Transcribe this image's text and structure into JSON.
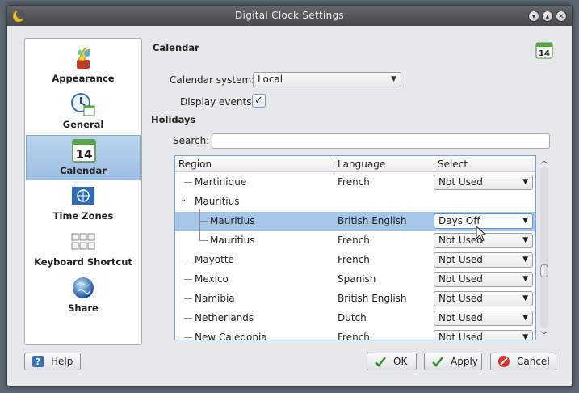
{
  "window": {
    "title": "Digital Clock Settings"
  },
  "sidebar": {
    "items": [
      {
        "label": "Appearance",
        "icon": "paint-brush-icon"
      },
      {
        "label": "General",
        "icon": "clock-calendar-icon"
      },
      {
        "label": "Calendar",
        "icon": "calendar-icon",
        "active": true
      },
      {
        "label": "Time Zones",
        "icon": "un-globe-icon"
      },
      {
        "label": "Keyboard Shortcut",
        "icon": "keyboard-icon"
      },
      {
        "label": "Share",
        "icon": "globe-icon"
      }
    ]
  },
  "page": {
    "title": "Calendar",
    "calendar_icon_text": "14",
    "calendar_system_label": "Calendar system:",
    "calendar_system_value": "Local",
    "display_events_label": "Display events:",
    "display_events_checked": true,
    "holidays_title": "Holidays",
    "search_label": "Search:",
    "search_value": ""
  },
  "table": {
    "columns": [
      "Region",
      "Language",
      "Select"
    ],
    "rows": [
      {
        "region": "Martinique",
        "language": "French",
        "select": "Not Used"
      },
      {
        "region": "Mauritius",
        "language": "",
        "select": "",
        "expanded": true
      },
      {
        "region": "Mauritius",
        "language": "British English",
        "select": "Days Off"
      },
      {
        "region": "Mauritius",
        "language": "French",
        "select": "Not Used"
      },
      {
        "region": "Mayotte",
        "language": "French",
        "select": "Not Used"
      },
      {
        "region": "Mexico",
        "language": "Spanish",
        "select": "Not Used"
      },
      {
        "region": "Namibia",
        "language": "British English",
        "select": "Not Used"
      },
      {
        "region": "Netherlands",
        "language": "Dutch",
        "select": "Not Used"
      },
      {
        "region": "New Caledonia",
        "language": "French",
        "select": "Not Used"
      }
    ]
  },
  "buttons": {
    "help": "Help",
    "ok": "OK",
    "apply": "Apply",
    "cancel": "Cancel"
  },
  "colors": {
    "selection": "#a7c7e8",
    "accent": "#6fa6dd"
  }
}
